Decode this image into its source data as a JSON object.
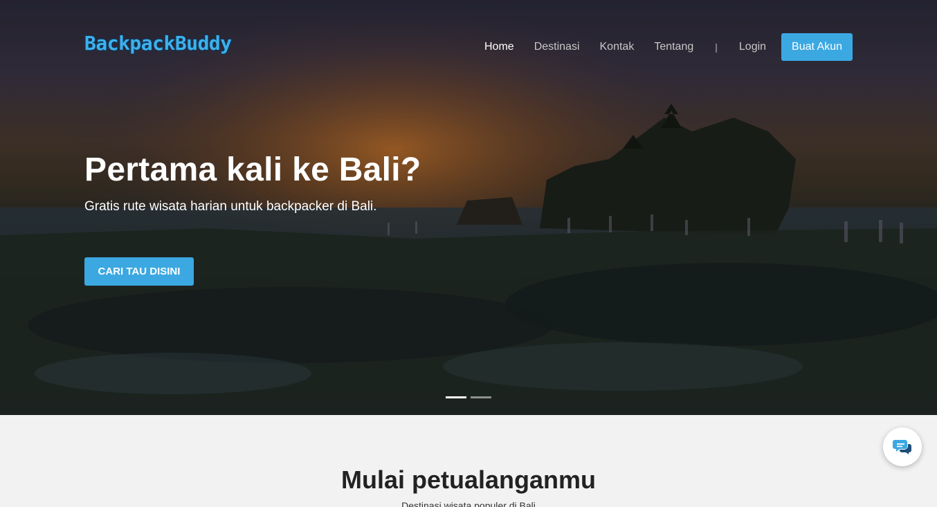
{
  "brand": {
    "logo_text": "BackpackBuddy"
  },
  "nav": {
    "items": [
      {
        "label": "Home",
        "active": true
      },
      {
        "label": "Destinasi",
        "active": false
      },
      {
        "label": "Kontak",
        "active": false
      },
      {
        "label": "Tentang",
        "active": false
      }
    ],
    "separator": "|",
    "login_label": "Login",
    "signup_label": "Buat Akun"
  },
  "hero": {
    "title": "Pertama kali ke Bali?",
    "subtitle": "Gratis rute wisata harian untuk backpacker di Bali.",
    "cta_label": "CARI TAU DISINI",
    "slides_total": 2,
    "slide_active": 1
  },
  "section": {
    "title": "Mulai petualanganmu",
    "subtitle": "Destinasi wisata populer di Bali"
  },
  "chat": {
    "icon": "chat-bubbles-icon"
  },
  "colors": {
    "accent": "#3ba8e2",
    "section_bg": "#f2f2f2"
  }
}
